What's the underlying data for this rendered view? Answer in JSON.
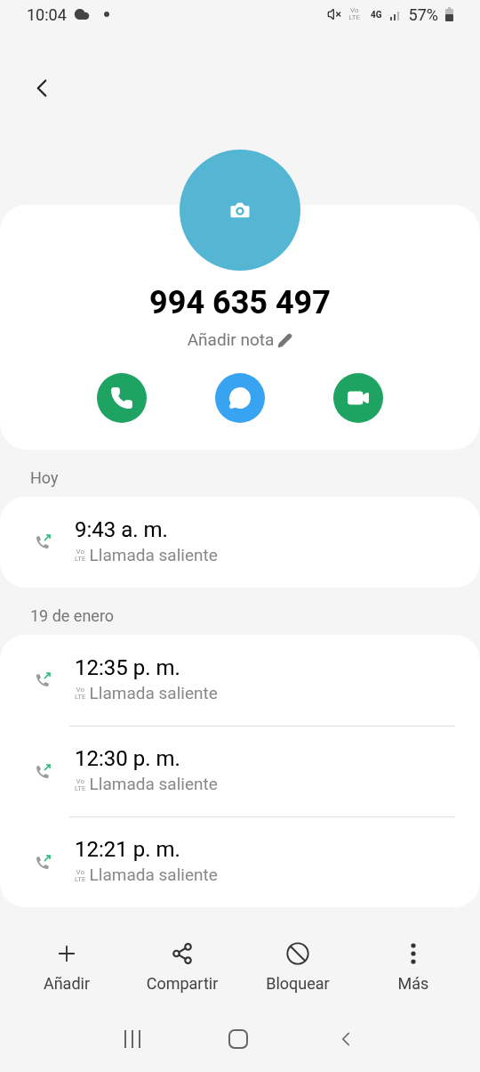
{
  "status_bar": {
    "time": "10:04",
    "volte_top": "Vo",
    "volte_bottom": "LTE",
    "network": "4G",
    "battery": "57%"
  },
  "contact": {
    "number": "994 635 497",
    "note": "Añadir nota"
  },
  "call_groups": [
    {
      "date": "Hoy",
      "calls": [
        {
          "time": "9:43 a. m.",
          "volte_top": "Vo",
          "volte_bottom": "LTE",
          "type": "Llamada saliente"
        }
      ]
    },
    {
      "date": "19 de enero",
      "calls": [
        {
          "time": "12:35 p. m.",
          "volte_top": "Vo",
          "volte_bottom": "LTE",
          "type": "Llamada saliente"
        },
        {
          "time": "12:30 p. m.",
          "volte_top": "Vo",
          "volte_bottom": "LTE",
          "type": "Llamada saliente"
        },
        {
          "time": "12:21 p. m.",
          "volte_top": "Vo",
          "volte_bottom": "LTE",
          "type": "Llamada saliente"
        }
      ]
    }
  ],
  "actions": [
    {
      "kind": "add",
      "label": "Añadir"
    },
    {
      "kind": "share",
      "label": "Compartir"
    },
    {
      "kind": "block",
      "label": "Bloquear"
    },
    {
      "kind": "more",
      "label": "Más"
    }
  ]
}
